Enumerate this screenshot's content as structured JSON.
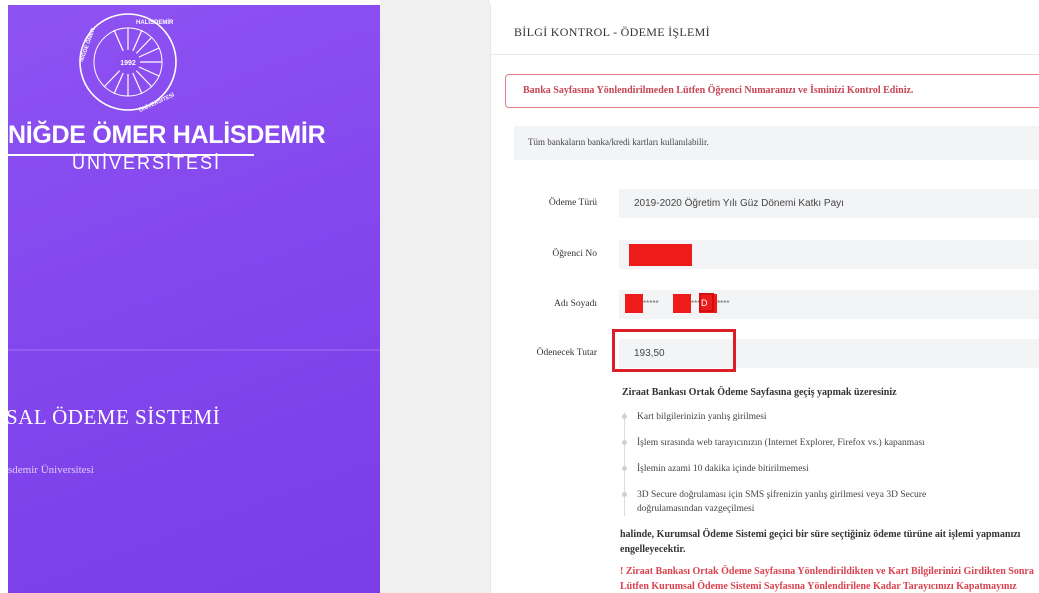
{
  "university": {
    "logo_year": "1992",
    "logo_arc_top": "HALİSDEMİR",
    "logo_arc_left": "NİĞDE ÖMER",
    "logo_arc_bottom": "ÜNİVERSİTESİ",
    "name": "NİĞDE ÖMER HALİSDEMİR",
    "subtitle": "ÜNİVERSİTESİ"
  },
  "sidebar": {
    "system_title": "SAL ÖDEME SİSTEMİ",
    "system_subtitle": "sdemir Üniversitesi"
  },
  "card": {
    "title": "BİLGİ KONTROL - ÖDEME İŞLEMİ",
    "warning": "Banka Sayfasına Yönlendirilmeden Lütfen Öğrenci Numaranızı ve İsminizi Kontrol Ediniz.",
    "info": "Tüm bankaların banka/kredi kartları kullanılabilir."
  },
  "form": {
    "payment_type_label": "Ödeme Türü",
    "payment_type_value": "2019-2020 Öğretim Yılı Güz Dönemi Katkı Payı",
    "student_no_label": "Öğrenci No",
    "name_label": "Adı Soyadı",
    "name_masked_1": "*****",
    "name_masked_2": "****",
    "name_masked_3": "D",
    "name_masked_4": "****",
    "amount_label": "Ödenecek Tutar",
    "amount_value": "193,50"
  },
  "notice": {
    "heading": "Ziraat Bankası Ortak Ödeme Sayfasına geçiş yapmak üzeresiniz",
    "items": [
      "Kart bilgilerinizin yanlış girilmesi",
      "İşlem sırasında web tarayıcınızın (Internet Explorer, Firefox vs.) kapanması",
      "İşlemin azami 10 dakika içinde bitirilmemesi",
      "3D Secure doğrulaması için SMS şifrenizin yanlış girilmesi veya 3D Secure doğrulamasından vazgeçilmesi"
    ],
    "result": "halinde, Kurumsal Ödeme Sistemi geçici bir süre seçtiğiniz ödeme türüne ait işlemi yapmanızı engelleyecektir.",
    "warning": "! Ziraat Bankası Ortak Ödeme Sayfasına Yönlendirildikten ve Kart Bilgilerinizi Girdikten Sonra Lütfen Kurumsal Ödeme Sistemi Sayfasına Yönlendirilene Kadar Tarayıcınızı Kapatmayınız"
  },
  "colors": {
    "sidebar_purple": "#8447ee",
    "warning_red": "#c64556",
    "highlight_red": "#dc1f26"
  }
}
